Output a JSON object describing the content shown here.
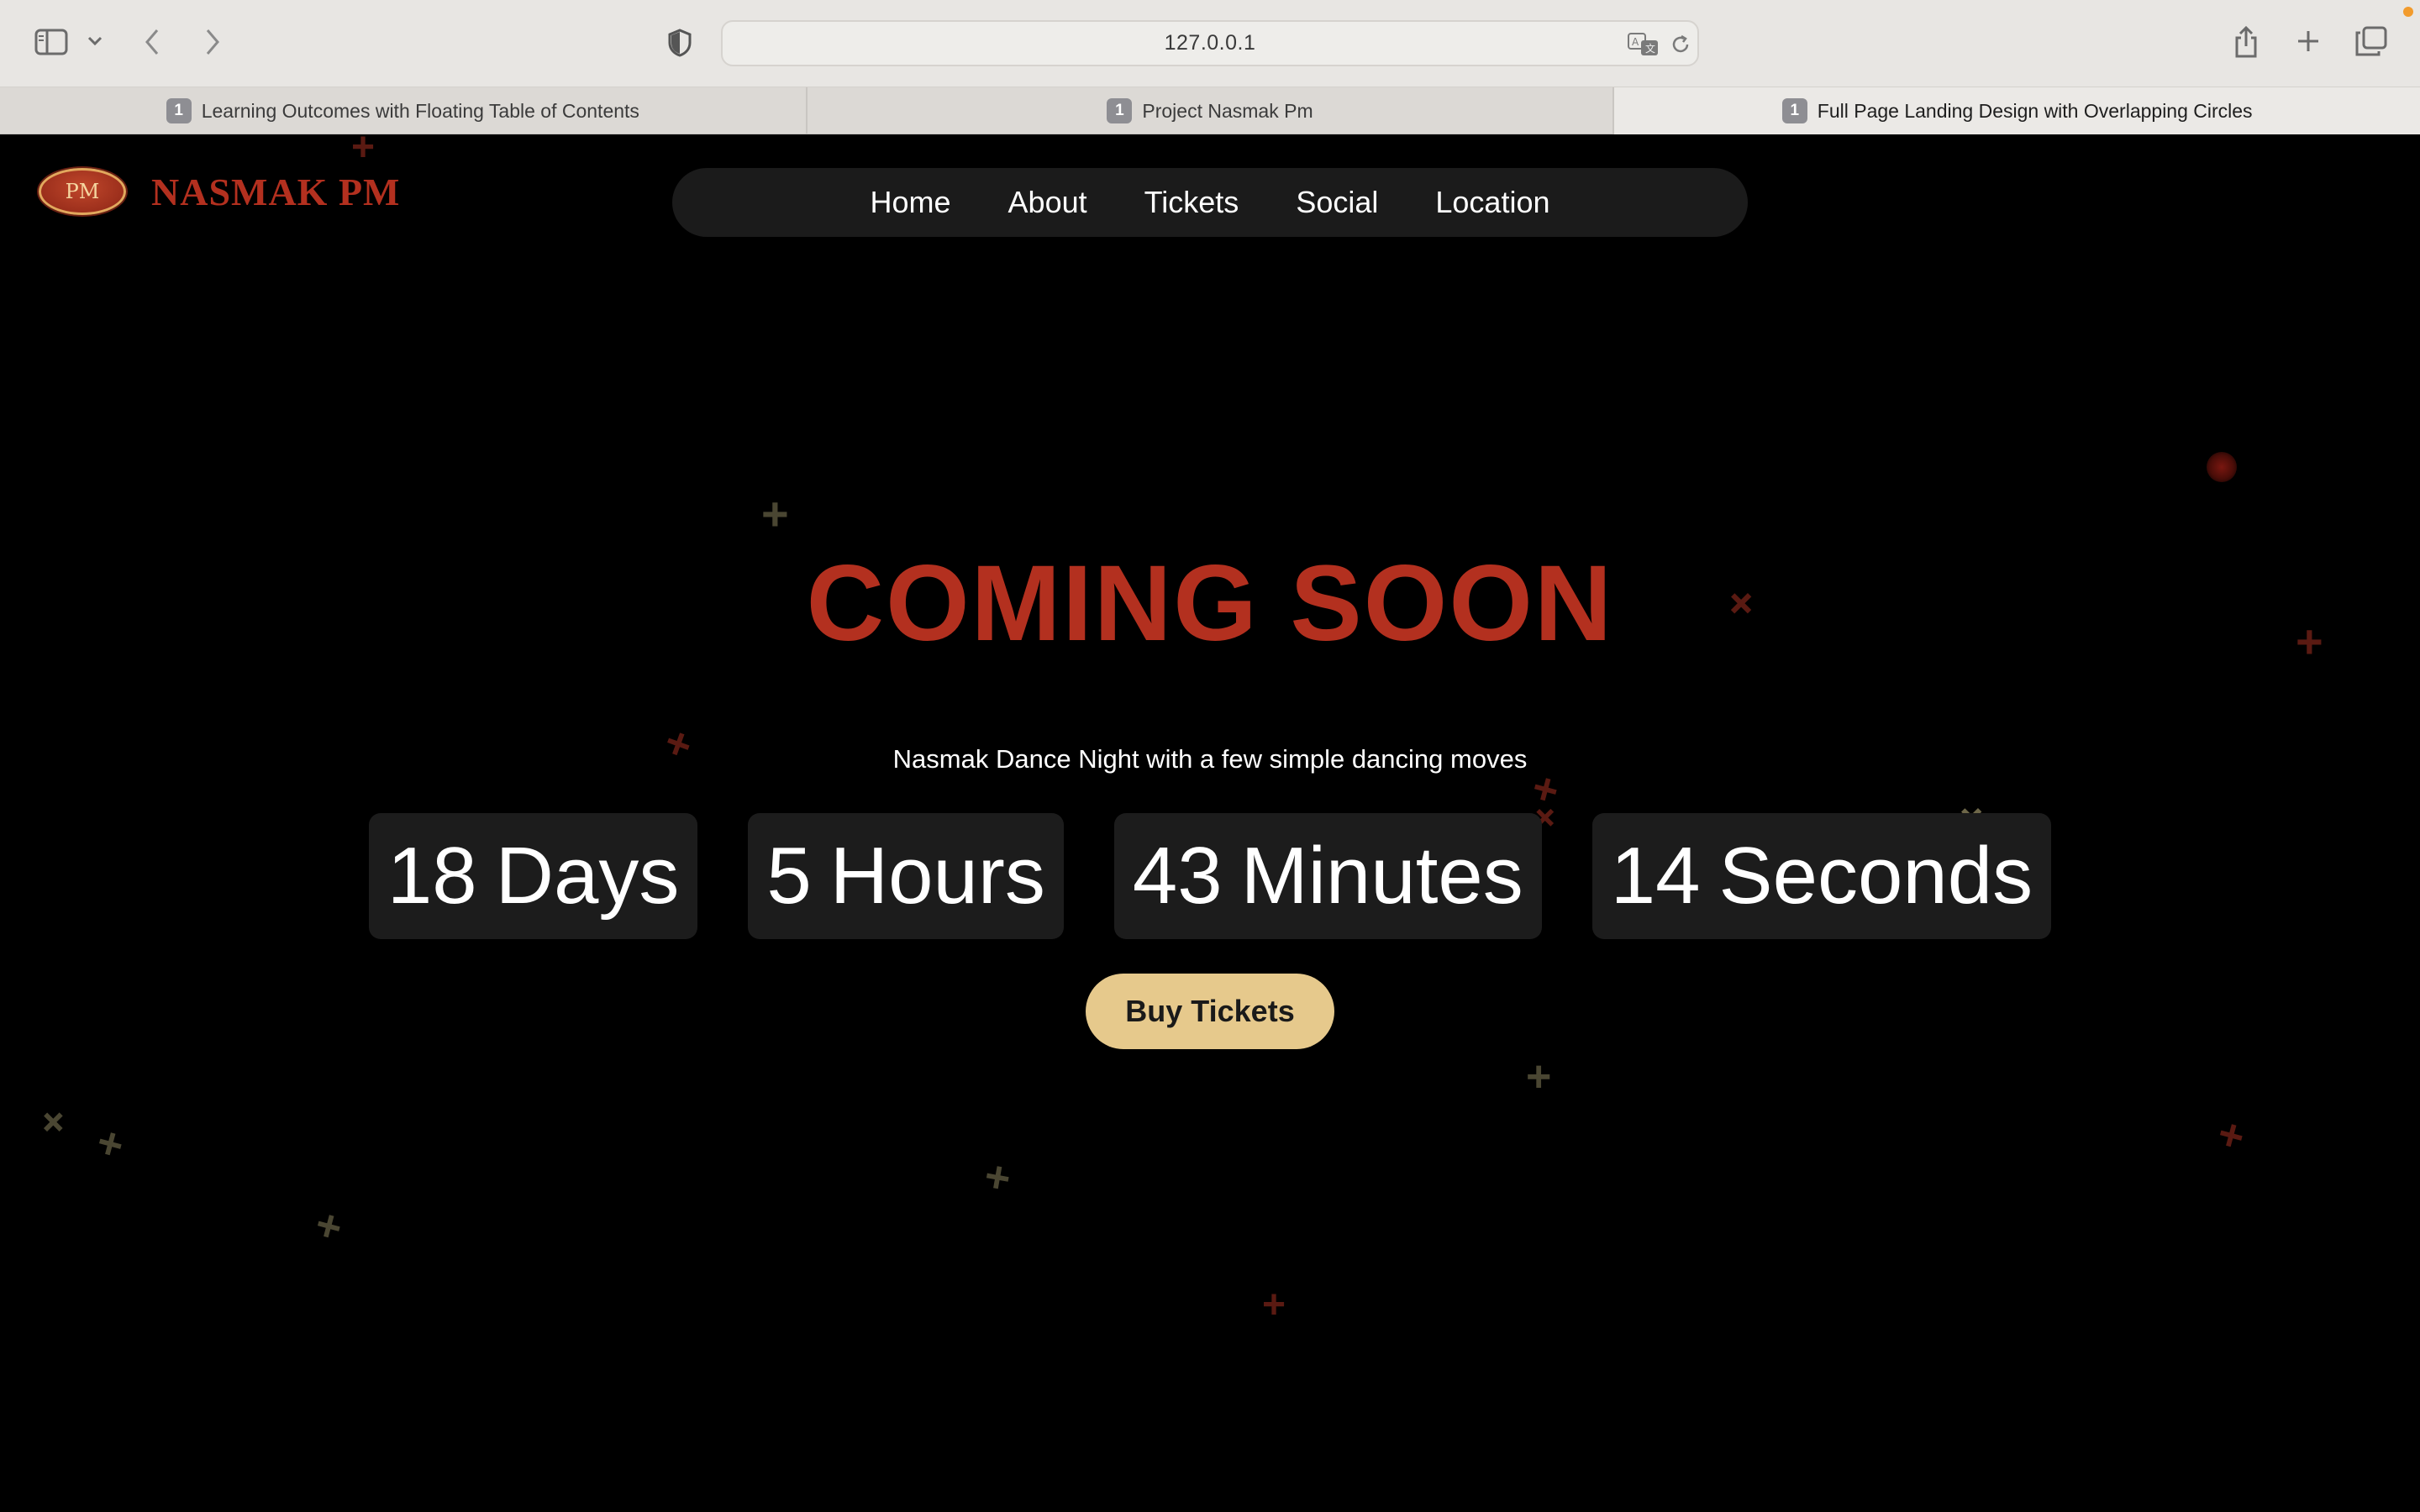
{
  "browser": {
    "url": "127.0.0.1",
    "tabs": [
      {
        "badge": "1",
        "title": "Learning Outcomes with Floating Table of Contents"
      },
      {
        "badge": "1",
        "title": "Project Nasmak Pm"
      },
      {
        "badge": "1",
        "title": "Full Page Landing Design with Overlapping Circles"
      }
    ],
    "active_tab": 2
  },
  "site": {
    "logo_badge": "PM",
    "logo_text": "NASMAK PM",
    "brand_color": "#b3301f",
    "accent_color": "#e6c98c",
    "nav": [
      "Home",
      "About",
      "Tickets",
      "Social",
      "Location"
    ]
  },
  "hero": {
    "headline": "COMING SOON",
    "subtitle": "Nasmak Dance Night with a few simple dancing moves",
    "countdown": [
      {
        "value": "18",
        "unit": "Days"
      },
      {
        "value": "5",
        "unit": "Hours"
      },
      {
        "value": "43",
        "unit": "Minutes"
      },
      {
        "value": "14",
        "unit": "Seconds"
      }
    ],
    "cta": "Buy Tickets"
  },
  "icons": {
    "sidebar": "sidebar-icon",
    "chevron": "chevron-down-icon",
    "back": "back-arrow-icon",
    "forward": "forward-arrow-icon",
    "shield": "privacy-shield-icon",
    "translate": "translate-icon",
    "reload": "reload-icon",
    "share": "share-icon",
    "new_tab": "new-tab-icon",
    "tab_overview": "tab-overview-icon",
    "decoration": "plus-sparkle-icon"
  }
}
